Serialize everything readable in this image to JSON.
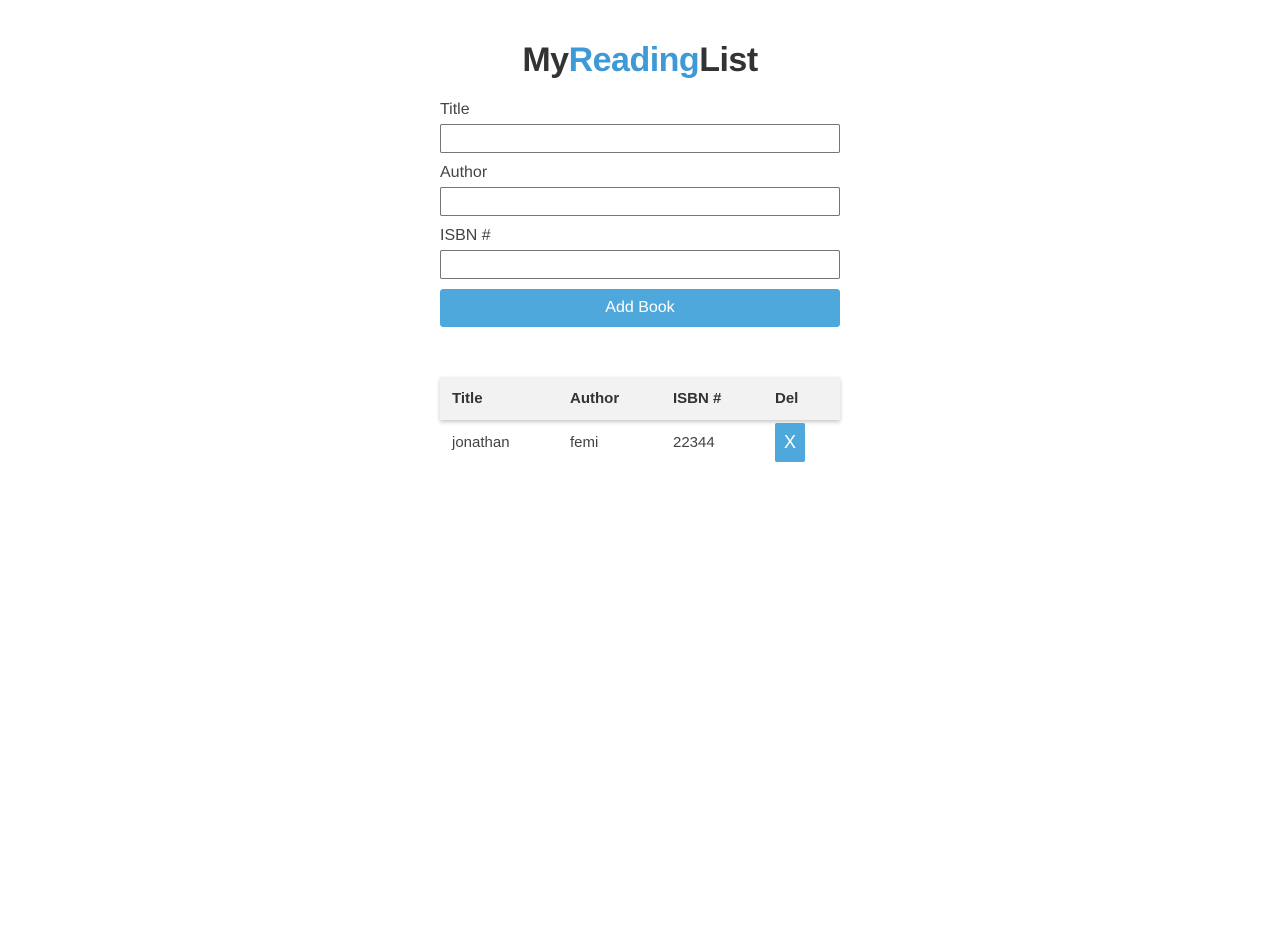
{
  "header": {
    "title_part1": "My",
    "title_part2": "Reading",
    "title_part3": "List"
  },
  "form": {
    "title_label": "Title",
    "title_value": "",
    "author_label": "Author",
    "author_value": "",
    "isbn_label": "ISBN #",
    "isbn_value": "",
    "submit_label": "Add Book"
  },
  "table": {
    "columns": [
      "Title",
      "Author",
      "ISBN #",
      "Del"
    ],
    "rows": [
      {
        "title": "jonathan",
        "author": "femi",
        "isbn": "22344",
        "delete_label": "X"
      }
    ]
  },
  "colors": {
    "accent": "#3d9ad6",
    "button": "#4fa8dc",
    "header_bg": "#f2f2f2",
    "text": "#333333"
  }
}
